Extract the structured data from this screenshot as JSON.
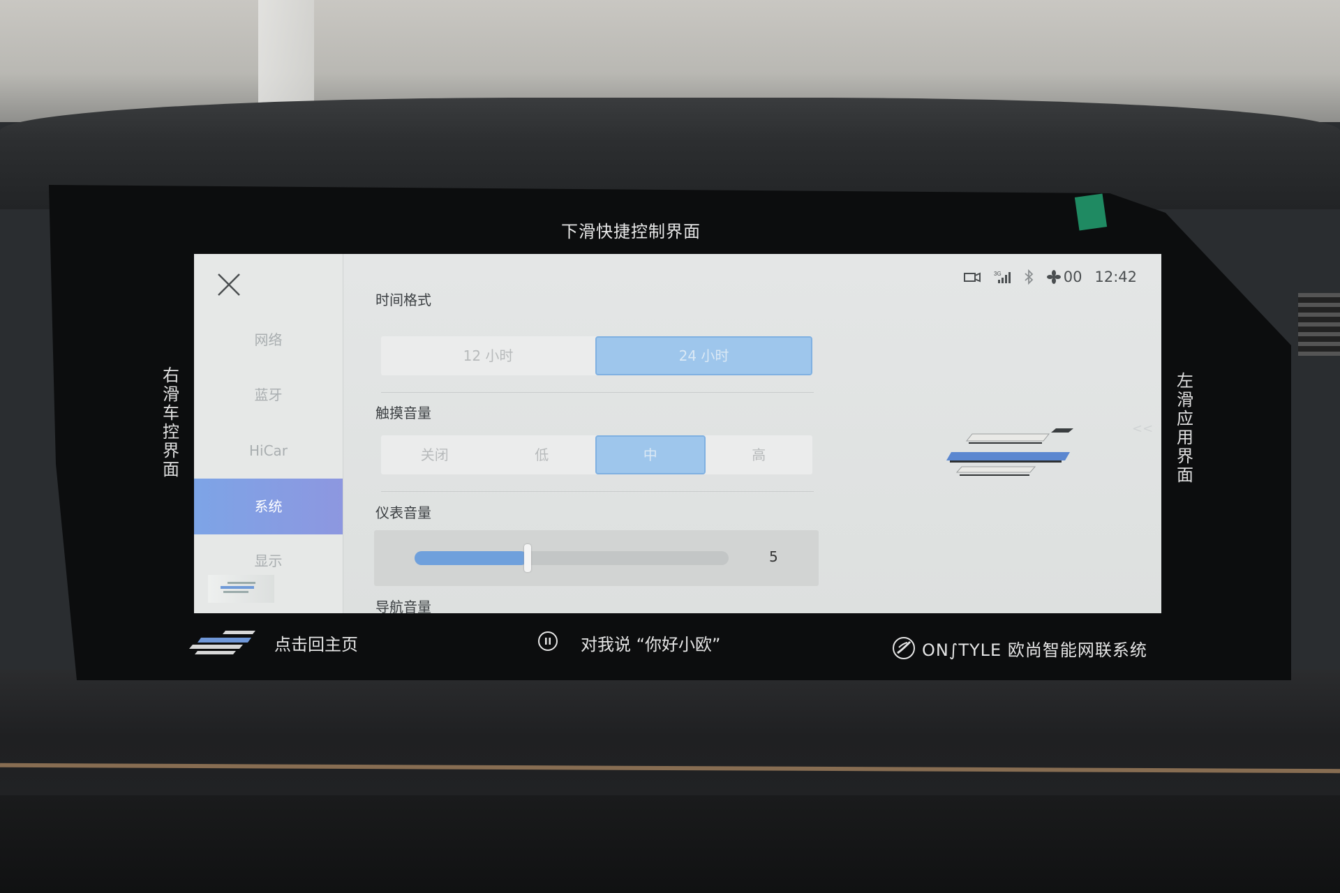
{
  "hints": {
    "top": "下滑快捷控制界面",
    "left": "右滑车控界面",
    "right": "左滑应用界面"
  },
  "status_bar": {
    "camera_icon": "dashcam-icon",
    "signal_icon": "cellular-signal-icon",
    "signal_label": "3G",
    "bluetooth_icon": "bluetooth-icon",
    "fan_icon": "fan-icon",
    "fan_value": "00",
    "time": "12:42"
  },
  "sidebar": {
    "items": [
      {
        "label": "网络",
        "active": false
      },
      {
        "label": "蓝牙",
        "active": false
      },
      {
        "label": "HiCar",
        "active": false
      },
      {
        "label": "系统",
        "active": true
      },
      {
        "label": "显示",
        "active": false
      }
    ]
  },
  "settings": {
    "time_format": {
      "label": "时间格式",
      "options": [
        "12 小时",
        "24 小时"
      ],
      "selected": "24 小时"
    },
    "touch_volume": {
      "label": "触摸音量",
      "options": [
        "关闭",
        "低",
        "中",
        "高"
      ],
      "selected": "中"
    },
    "cluster_volume": {
      "label": "仪表音量",
      "value": 5,
      "fill_fraction": 0.36
    },
    "nav_volume": {
      "label": "导航音量"
    }
  },
  "bottom_bar": {
    "home_label": "点击回主页",
    "voice_label": "对我说 “你好小欧”",
    "brand_label": "ON∫TYLE 欧尚智能网联系统"
  },
  "colors": {
    "accent": "#7da4e6",
    "selected_option": "#9ec6ec"
  }
}
